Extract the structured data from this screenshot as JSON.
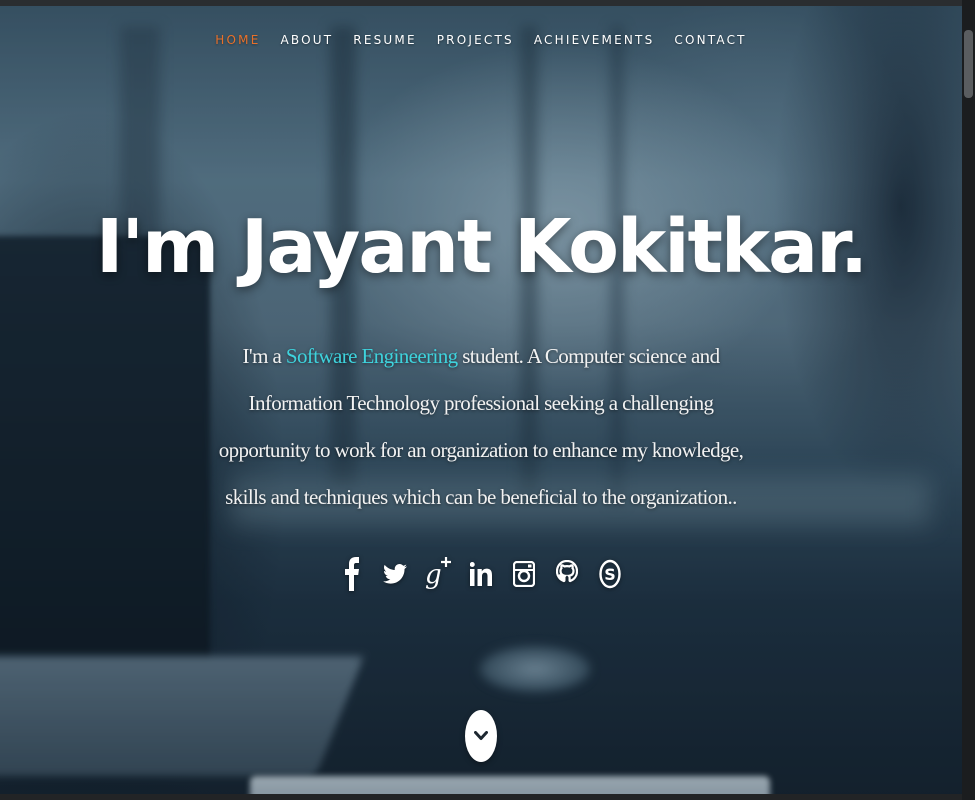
{
  "nav": {
    "items": [
      {
        "label": "HOME",
        "active": true
      },
      {
        "label": "ABOUT",
        "active": false
      },
      {
        "label": "RESUME",
        "active": false
      },
      {
        "label": "PROJECTS",
        "active": false
      },
      {
        "label": "ACHIEVEMENTS",
        "active": false
      },
      {
        "label": "CONTACT",
        "active": false
      }
    ],
    "active_color": "#e8702a"
  },
  "hero": {
    "headline": "I'm Jayant Kokitkar.",
    "bio_prefix": "I'm a ",
    "bio_highlight": "Software Engineering",
    "bio_rest": " student. A Computer science and Information Technology professional seeking a challenging opportunity to work for an organization to enhance my knowledge, skills and techniques which can be beneficial to the organization..",
    "highlight_color": "#3ed3dd"
  },
  "social": [
    {
      "icon": "facebook-icon"
    },
    {
      "icon": "twitter-icon"
    },
    {
      "icon": "google-plus-icon"
    },
    {
      "icon": "linkedin-icon"
    },
    {
      "icon": "instagram-icon"
    },
    {
      "icon": "github-icon"
    },
    {
      "icon": "skype-icon"
    }
  ],
  "scroll_button": {
    "icon": "chevron-down-icon"
  }
}
